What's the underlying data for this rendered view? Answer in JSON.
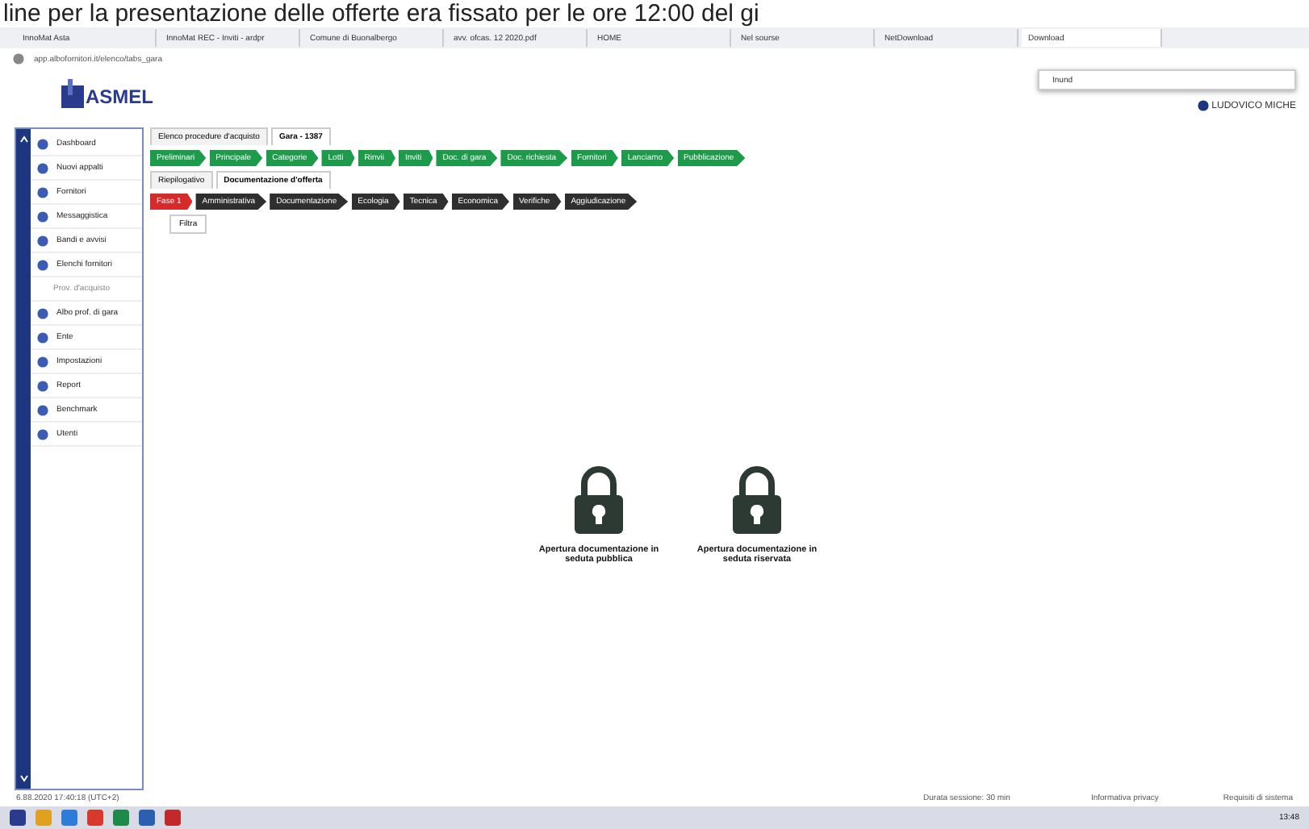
{
  "caption": "line per la presentazione delle offerte era fissato per le ore 12:00 del gi",
  "browser_tabs": [
    {
      "label": "InnoMat Asta",
      "selected": false
    },
    {
      "label": "InnoMat REC - Inviti - ardpr",
      "selected": false
    },
    {
      "label": "Comune di Buonalbergo",
      "selected": false
    },
    {
      "label": "avv. ofcas. 12 2020.pdf",
      "selected": false
    },
    {
      "label": "HOME",
      "selected": false
    },
    {
      "label": "Nel sourse",
      "selected": false
    },
    {
      "label": "NetDownload",
      "selected": false
    },
    {
      "label": "Download",
      "selected": true
    }
  ],
  "address": "app.albofornitori.it/elenco/tabs_gara",
  "find_bar": {
    "value": "Inund"
  },
  "logo": "ASMEL",
  "user": "LUDOVICO MICHE",
  "sidebar": [
    {
      "label": "Dashboard",
      "kind": "item"
    },
    {
      "label": "Nuovi appalti",
      "kind": "item"
    },
    {
      "label": "Fornitori",
      "kind": "item"
    },
    {
      "label": "Messaggistica",
      "kind": "item"
    },
    {
      "label": "Bandi e avvisi",
      "kind": "item"
    },
    {
      "label": "Elenchi fornitori",
      "kind": "item",
      "children": [
        {
          "label": "Prov. d'acquisto"
        }
      ]
    },
    {
      "label": "Albo prof. di gara",
      "kind": "item"
    },
    {
      "label": "Ente",
      "kind": "item"
    },
    {
      "label": "Impostazioni",
      "kind": "item"
    },
    {
      "label": "Report",
      "kind": "item"
    },
    {
      "label": "Benchmark",
      "kind": "item"
    },
    {
      "label": "Utenti",
      "kind": "item"
    }
  ],
  "page_tabs": [
    {
      "label": "Elenco procedure d'acquisto",
      "selected": false
    },
    {
      "label": "Gara - 1387",
      "selected": true
    }
  ],
  "steps": [
    {
      "label": "Preliminari",
      "kind": "done"
    },
    {
      "label": "Principale",
      "kind": "done"
    },
    {
      "label": "Categorie",
      "kind": "done"
    },
    {
      "label": "Lotti",
      "kind": "done"
    },
    {
      "label": "Rinvii",
      "kind": "done"
    },
    {
      "label": "Inviti",
      "kind": "done"
    },
    {
      "label": "Doc. di gara",
      "kind": "done"
    },
    {
      "label": "Doc. richiesta",
      "kind": "done"
    },
    {
      "label": "Fornitori",
      "kind": "done"
    },
    {
      "label": "Lanciamo",
      "kind": "done"
    },
    {
      "label": "Pubblicazione",
      "kind": "done"
    }
  ],
  "sub_tabs": [
    {
      "label": "Riepilogativo",
      "selected": false
    },
    {
      "label": "Documentazione d'offerta",
      "selected": true
    }
  ],
  "phases": [
    {
      "label": "Fase 1",
      "kind": "alert"
    },
    {
      "label": "Amministrativa",
      "kind": "todo"
    },
    {
      "label": "Documentazione",
      "kind": "todo"
    },
    {
      "label": "Ecologia",
      "kind": "todo"
    },
    {
      "label": "Tecnica",
      "kind": "todo"
    },
    {
      "label": "Economica",
      "kind": "todo"
    },
    {
      "label": "Verifiche",
      "kind": "todo"
    },
    {
      "label": "Aggiudicazione",
      "kind": "todo"
    }
  ],
  "filter_button": "Filtra",
  "cards": [
    {
      "label": "Apertura documentazione in seduta pubblica"
    },
    {
      "label": "Apertura documentazione in seduta riservata"
    }
  ],
  "footer": {
    "timestamp": "6.88.2020 17:40:18 (UTC+2)",
    "session": "Durata sessione: 30 min",
    "privacy": "Informativa privacy",
    "requirements": "Requisiti di sistema"
  },
  "clock": "13:48"
}
